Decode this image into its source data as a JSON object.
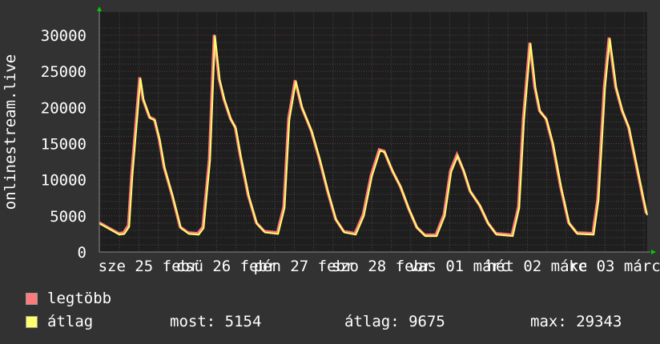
{
  "chart_data": {
    "type": "line",
    "ylabel": "onlinestream.live",
    "ylim": [
      0,
      30000
    ],
    "yticks": [
      "0",
      "5000",
      "10000",
      "15000",
      "20000",
      "25000",
      "30000"
    ],
    "xticks": [
      "sze 25 febr",
      "csü 26 febr",
      "pén 27 febr",
      "szo 28 febr",
      "vas 01 márc",
      "hét 02 márc",
      "ke 03 márc"
    ],
    "grid": true,
    "series": [
      {
        "name": "legtöbb",
        "color": "#ff7b7b"
      },
      {
        "name": "átlag",
        "color": "#ffff6e"
      }
    ],
    "points": [
      [
        "02-24 21:00",
        3900
      ],
      [
        "02-25 03:00",
        2400
      ],
      [
        "02-25 04:30",
        2500
      ],
      [
        "02-25 06:00",
        3500
      ],
      [
        "02-25 07:00",
        10500
      ],
      [
        "02-25 09:30",
        24000
      ],
      [
        "02-25 10:30",
        21000
      ],
      [
        "02-25 12:30",
        18500
      ],
      [
        "02-25 14:00",
        18200
      ],
      [
        "02-25 15:30",
        15500
      ],
      [
        "02-25 17:00",
        11600
      ],
      [
        "02-25 19:30",
        7700
      ],
      [
        "02-25 22:00",
        3300
      ],
      [
        "02-26 00:30",
        2500
      ],
      [
        "02-26 03:30",
        2400
      ],
      [
        "02-26 05:00",
        3300
      ],
      [
        "02-26 07:00",
        12700
      ],
      [
        "02-26 08:30",
        29900
      ],
      [
        "02-26 10:00",
        23800
      ],
      [
        "02-26 11:30",
        21000
      ],
      [
        "02-26 13:30",
        18300
      ],
      [
        "02-26 15:00",
        17100
      ],
      [
        "02-26 16:30",
        13300
      ],
      [
        "02-26 19:00",
        7700
      ],
      [
        "02-26 21:30",
        3900
      ],
      [
        "02-27 00:00",
        2700
      ],
      [
        "02-27 04:00",
        2500
      ],
      [
        "02-27 06:00",
        6100
      ],
      [
        "02-27 07:30",
        18300
      ],
      [
        "02-27 09:30",
        23600
      ],
      [
        "02-27 11:30",
        19900
      ],
      [
        "02-27 14:30",
        16600
      ],
      [
        "02-27 17:00",
        12700
      ],
      [
        "02-27 19:30",
        8300
      ],
      [
        "02-27 22:00",
        4400
      ],
      [
        "02-28 00:30",
        2700
      ],
      [
        "02-28 04:00",
        2400
      ],
      [
        "02-28 06:30",
        5000
      ],
      [
        "02-28 09:00",
        10500
      ],
      [
        "02-28 11:30",
        14000
      ],
      [
        "02-28 13:00",
        13800
      ],
      [
        "02-28 15:30",
        11100
      ],
      [
        "02-28 18:00",
        8900
      ],
      [
        "02-28 20:30",
        5900
      ],
      [
        "02-28 23:00",
        3300
      ],
      [
        "03-01 01:30",
        2200
      ],
      [
        "03-01 05:00",
        2200
      ],
      [
        "03-01 07:30",
        5000
      ],
      [
        "03-01 09:30",
        11100
      ],
      [
        "03-01 11:30",
        13300
      ],
      [
        "03-01 13:30",
        11100
      ],
      [
        "03-01 15:30",
        8300
      ],
      [
        "03-01 18:30",
        6300
      ],
      [
        "03-01 21:00",
        3900
      ],
      [
        "03-01 23:30",
        2400
      ],
      [
        "03-02 04:30",
        2200
      ],
      [
        "03-02 06:30",
        6100
      ],
      [
        "03-02 08:00",
        18300
      ],
      [
        "03-02 10:00",
        28800
      ],
      [
        "03-02 11:30",
        22700
      ],
      [
        "03-02 13:00",
        19400
      ],
      [
        "03-02 15:00",
        18300
      ],
      [
        "03-02 17:00",
        14900
      ],
      [
        "03-02 19:30",
        8900
      ],
      [
        "03-02 22:00",
        3900
      ],
      [
        "03-03 00:30",
        2500
      ],
      [
        "03-03 05:30",
        2400
      ],
      [
        "03-03 07:00",
        7200
      ],
      [
        "03-03 09:00",
        22700
      ],
      [
        "03-03 10:30",
        29500
      ],
      [
        "03-03 12:30",
        22700
      ],
      [
        "03-03 14:30",
        19400
      ],
      [
        "03-03 16:30",
        17100
      ],
      [
        "03-03 19:00",
        11600
      ],
      [
        "03-03 21:00",
        7200
      ],
      [
        "03-03 22:00",
        5154
      ]
    ]
  },
  "legend": {
    "max_label": "legtöbb",
    "avg_label": "átlag",
    "now": "most: 5154",
    "average": "átlag: 9675",
    "maximum": "max: 29343"
  }
}
